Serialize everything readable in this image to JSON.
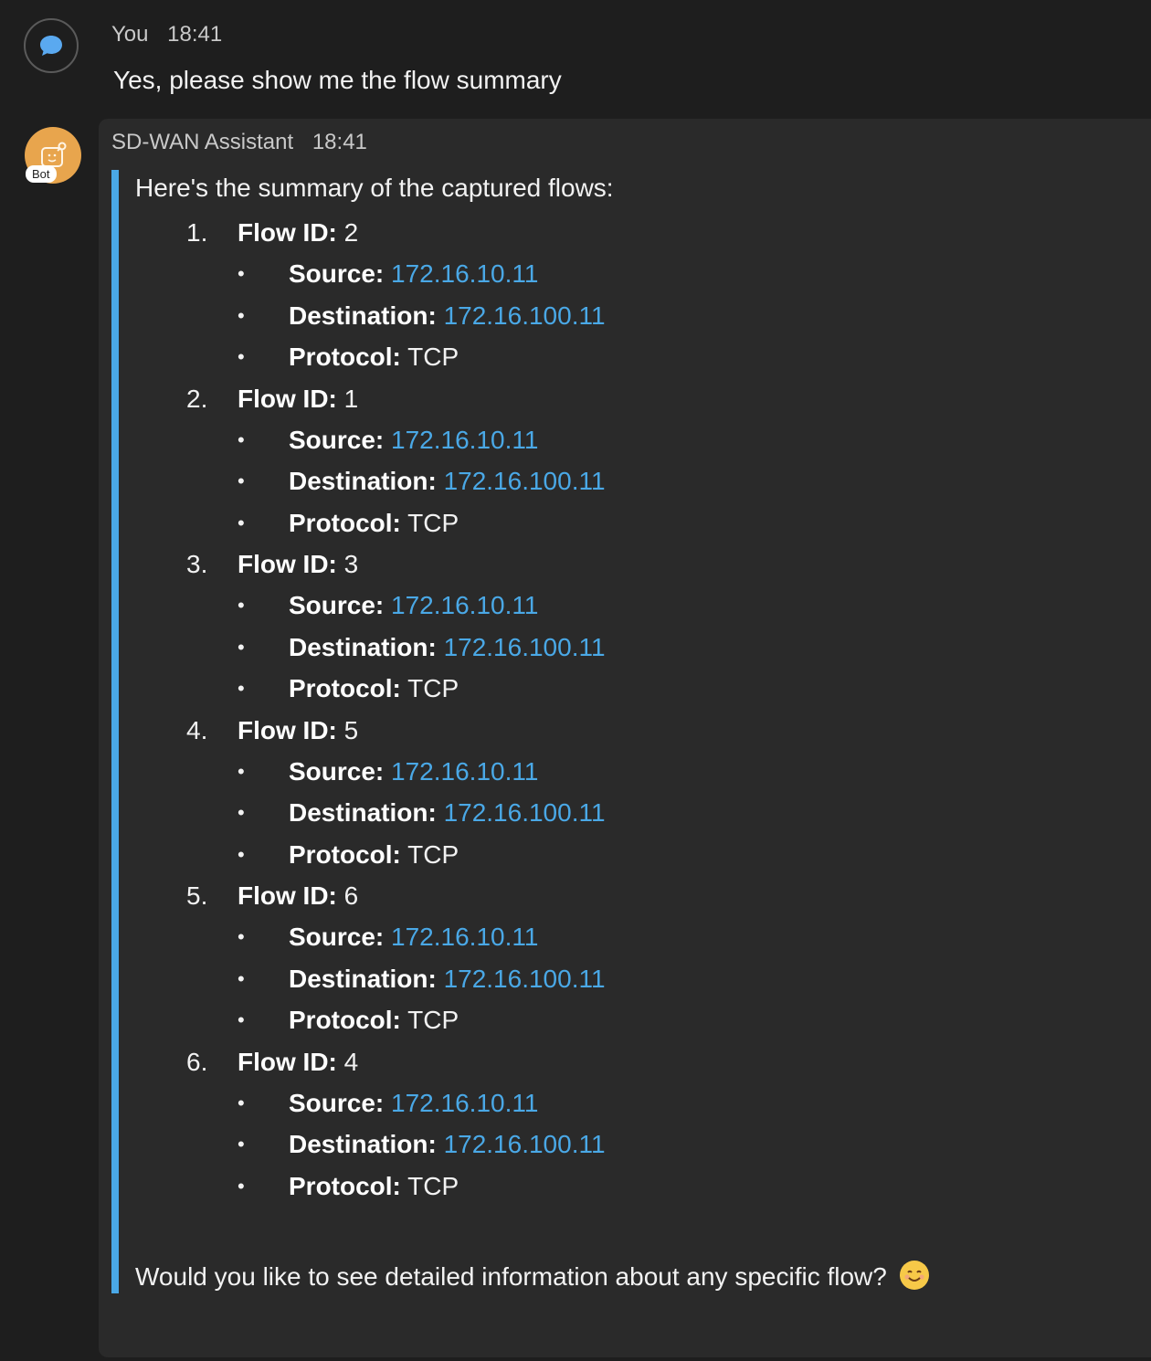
{
  "user_message": {
    "author": "You",
    "time": "18:41",
    "text": "Yes, please show me the flow summary",
    "avatar_icon": "chat-bubble-icon"
  },
  "bot_message": {
    "author": "SD-WAN Assistant",
    "time": "18:41",
    "badge": "Bot",
    "avatar_icon": "bot-icon",
    "intro": "Here's the summary of the captured flows:",
    "flows": [
      {
        "num": "1.",
        "id_label": "Flow ID:",
        "id": "2",
        "src_label": "Source:",
        "src": "172.16.10.11",
        "dst_label": "Destination:",
        "dst": "172.16.100.11",
        "proto_label": "Protocol:",
        "proto": "TCP"
      },
      {
        "num": "2.",
        "id_label": "Flow ID:",
        "id": "1",
        "src_label": "Source:",
        "src": "172.16.10.11",
        "dst_label": "Destination:",
        "dst": "172.16.100.11",
        "proto_label": "Protocol:",
        "proto": "TCP"
      },
      {
        "num": "3.",
        "id_label": "Flow ID:",
        "id": "3",
        "src_label": "Source:",
        "src": "172.16.10.11",
        "dst_label": "Destination:",
        "dst": "172.16.100.11",
        "proto_label": "Protocol:",
        "proto": "TCP"
      },
      {
        "num": "4.",
        "id_label": "Flow ID:",
        "id": "5",
        "src_label": "Source:",
        "src": "172.16.10.11",
        "dst_label": "Destination:",
        "dst": "172.16.100.11",
        "proto_label": "Protocol:",
        "proto": "TCP"
      },
      {
        "num": "5.",
        "id_label": "Flow ID:",
        "id": "6",
        "src_label": "Source:",
        "src": "172.16.10.11",
        "dst_label": "Destination:",
        "dst": "172.16.100.11",
        "proto_label": "Protocol:",
        "proto": "TCP"
      },
      {
        "num": "6.",
        "id_label": "Flow ID:",
        "id": "4",
        "src_label": "Source:",
        "src": "172.16.10.11",
        "dst_label": "Destination:",
        "dst": "172.16.100.11",
        "proto_label": "Protocol:",
        "proto": "TCP"
      }
    ],
    "closing": "Would you like to see detailed information about any specific flow?",
    "closing_emoji": "smiling-face-icon"
  },
  "colors": {
    "background": "#1e1e1e",
    "card": "#2a2a2a",
    "accent": "#4aa8e6",
    "bot_avatar": "#e8a54d"
  }
}
